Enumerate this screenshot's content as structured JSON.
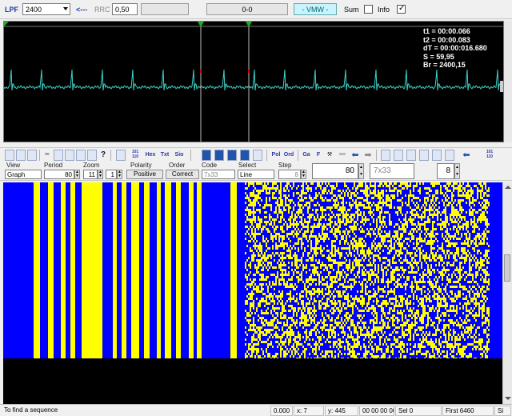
{
  "topbar": {
    "lpf_label": "LPF",
    "lpf_value": "2400",
    "arrow_glyph": "<---",
    "rrc_label": "RRC",
    "rrc_value": "0,50",
    "counter": "0-0",
    "vmw": "- VMW -",
    "sum_label": "Sum",
    "sum_checked": false,
    "info_label": "Info",
    "info_checked": true
  },
  "scope": {
    "readouts": {
      "t1": "t1 = 00:00.066",
      "t2": "t2 = 00:00.083",
      "dT": "dT = 00:00:016.680",
      "S": "S = 59,95",
      "Br": "Br = 2400,15"
    },
    "trace_color": "#3fd1c8",
    "marker_color": "#1faa1f",
    "background": "#000000"
  },
  "toolbar": {
    "text_buttons": [
      "101 110",
      "Hex",
      "Txt",
      "Sio",
      "Pol",
      "Ord",
      "Ga",
      "F",
      "101 110"
    ],
    "icons": [
      "open-icon",
      "save-icon",
      "save-as-icon",
      "cut-icon",
      "copy-icon",
      "paste-icon",
      "print-icon",
      "disk-icon",
      "help-icon",
      "grid-icon",
      "layout-a-icon",
      "layout-b-icon",
      "layout-c-icon",
      "layout-d-icon",
      "binoculars-icon",
      "back-arrow-icon",
      "forward-arrow-icon",
      "table-icon",
      "list-icon",
      "bars-icon",
      "align-icon",
      "sort-icon",
      "chart-icon",
      "back-icon"
    ]
  },
  "controls": {
    "view": {
      "label": "View",
      "value": "Graph"
    },
    "period": {
      "label": "Period",
      "value": "80"
    },
    "zoom": {
      "label": "Zoom",
      "value": "11",
      "value2": "1"
    },
    "polarity": {
      "label": "Polarity",
      "value": "Positive"
    },
    "order": {
      "label": "Order",
      "value": "Correct"
    },
    "code": {
      "label": "Code",
      "value": "7x33"
    },
    "select": {
      "label": "Select",
      "value": "Line"
    },
    "step": {
      "label": "Step",
      "value": "8"
    },
    "period_big": "80",
    "code_big": "7x33",
    "step_big": "8"
  },
  "bits": {
    "color_one": "#ffff00",
    "color_zero": "#0000ff"
  },
  "status": {
    "message": "To find a sequence",
    "value": "0.000",
    "x": "x: 7",
    "y": "y: 445",
    "hex": "00 00 00 00",
    "sel": "Sel 0",
    "first": "First 6460",
    "si": "Si"
  }
}
